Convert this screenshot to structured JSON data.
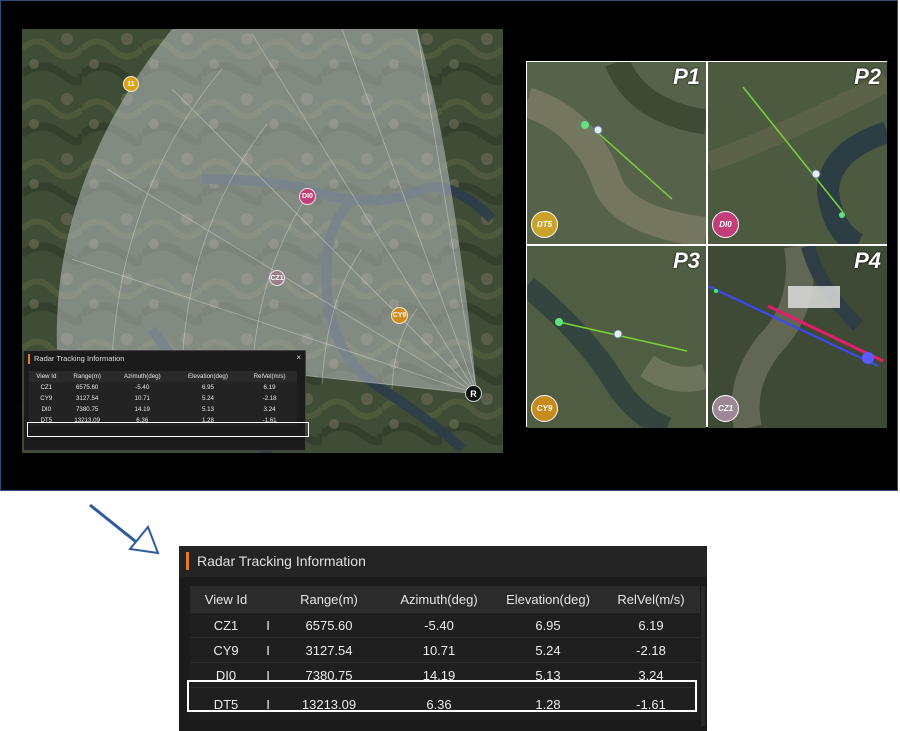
{
  "main_map": {
    "markers": [
      {
        "id": "11",
        "color": "#d9a21b"
      },
      {
        "id": "DI0",
        "color": "#c23d7a"
      },
      {
        "id": "CZ1",
        "color": "#9a7e8a"
      },
      {
        "id": "CY9",
        "color": "#d18a1d"
      },
      {
        "id": "R",
        "color": "#111111"
      }
    ]
  },
  "panels": [
    {
      "label": "P1",
      "view": "DT5",
      "badge_color": "#c9a227"
    },
    {
      "label": "P2",
      "view": "DI0",
      "badge_color": "#c23d7a"
    },
    {
      "label": "P3",
      "view": "CY9",
      "badge_color": "#c98a1d"
    },
    {
      "label": "P4",
      "view": "CZ1",
      "badge_color": "#9e8796"
    }
  ],
  "radar": {
    "title": "Radar Tracking Information",
    "close": "×",
    "columns": [
      "View Id",
      "Range(m)",
      "Azimuth(deg)",
      "Elevation(deg)",
      "RelVel(m/s)"
    ],
    "separator": "I",
    "rows": [
      {
        "view": "CZ1",
        "range": "6575.60",
        "azimuth": "-5.40",
        "elevation": "6.95",
        "relvel": "6.19"
      },
      {
        "view": "CY9",
        "range": "3127.54",
        "azimuth": "10.71",
        "elevation": "5.24",
        "relvel": "-2.18"
      },
      {
        "view": "DI0",
        "range": "7380.75",
        "azimuth": "14.19",
        "elevation": "5.13",
        "relvel": "3.24"
      },
      {
        "view": "DT5",
        "range": "13213.09",
        "azimuth": "6.36",
        "elevation": "1.28",
        "relvel": "-1.61"
      }
    ],
    "highlighted_view": "DT5"
  },
  "colors": {
    "accent": "#e07b22",
    "highlight": "#ffffff"
  }
}
